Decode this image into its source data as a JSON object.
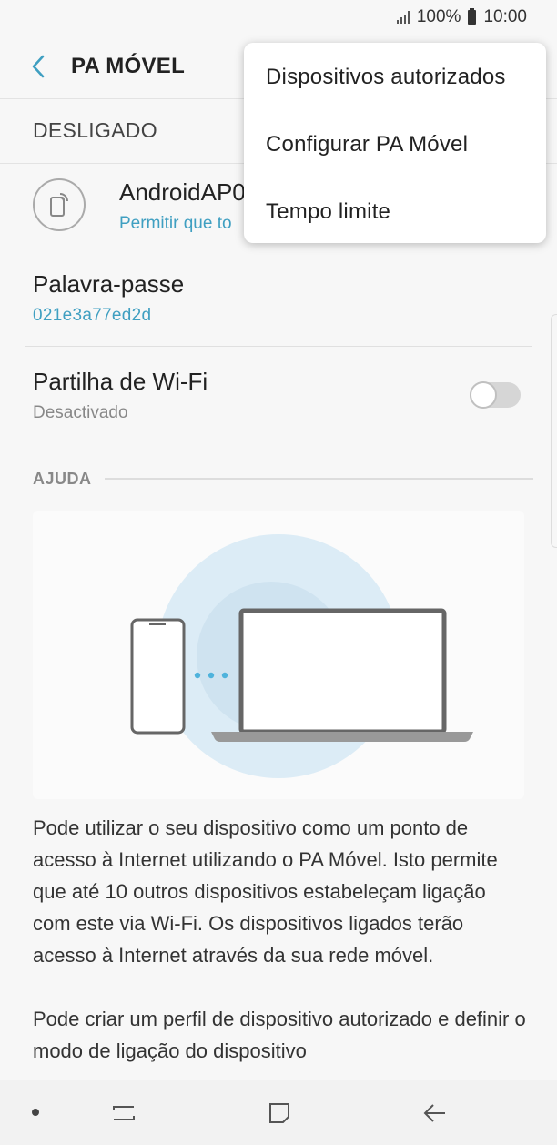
{
  "status_bar": {
    "battery": "100%",
    "time": "10:00"
  },
  "header": {
    "title": "PA MÓVEL"
  },
  "state": {
    "label": "DESLIGADO"
  },
  "network": {
    "name": "AndroidAP0",
    "subtitle": "Permitir que to"
  },
  "password": {
    "title": "Palavra-passe",
    "value": "021e3a77ed2d"
  },
  "wifi_sharing": {
    "title": "Partilha de Wi-Fi",
    "status": "Desactivado",
    "enabled": false
  },
  "help": {
    "header": "AJUDA",
    "paragraphs": [
      "Pode utilizar o seu dispositivo como um ponto de acesso à Internet utilizando o PA Móvel. Isto permite que até 10 outros dispositivos estabeleçam ligação com este via Wi-Fi. Os dispositivos ligados terão acesso à Internet através da sua rede móvel.",
      "Pode criar um perfil de dispositivo autorizado e definir o modo de ligação do dispositivo"
    ]
  },
  "menu": {
    "items": [
      {
        "label": "Dispositivos autorizados"
      },
      {
        "label": "Configurar PA Móvel"
      },
      {
        "label": "Tempo limite"
      }
    ]
  },
  "colors": {
    "accent": "#3f9fc1",
    "background": "#f7f7f7",
    "illustration_outer": "#dcecf6",
    "illustration_inner": "#cfe3f0"
  },
  "icons": {
    "back": "back-arrow-icon",
    "network": "hotspot-phone-icon",
    "nav_recents": "recents-icon",
    "nav_home": "home-icon",
    "nav_back": "back-icon"
  }
}
